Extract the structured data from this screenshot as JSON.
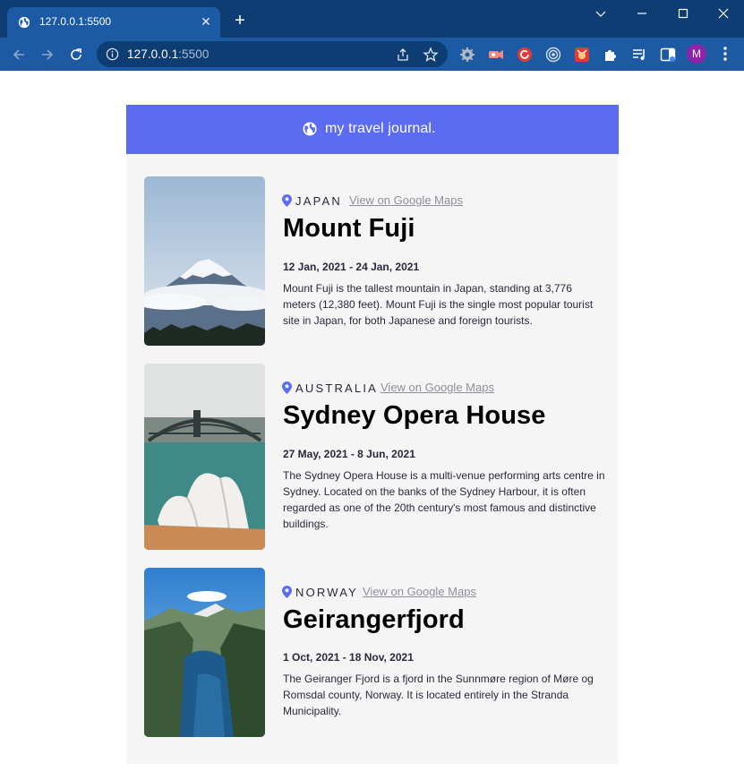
{
  "browser": {
    "tab_title": "127.0.0.1:5500",
    "url_host": "127.0.0.1",
    "url_port": ":5500",
    "profile_initial": "M"
  },
  "page": {
    "header_title": "my travel journal.",
    "map_link_label": "View on Google Maps",
    "accent_color": "#5b6cf2",
    "pin_color": "#5b6cf2",
    "entries": [
      {
        "country": "JAPAN",
        "title": "Mount Fuji",
        "start_date": "12 Jan, 2021",
        "end_date": "24 Jan, 2021",
        "description": "Mount Fuji is the tallest mountain in Japan, standing at 3,776 meters (12,380 feet). Mount Fuji is the single most popular tourist site in Japan, for both Japanese and foreign tourists."
      },
      {
        "country": "AUSTRALIA",
        "title": "Sydney Opera House",
        "start_date": "27 May, 2021",
        "end_date": "8 Jun, 2021",
        "description": "The Sydney Opera House is a multi-venue performing arts centre in Sydney. Located on the banks of the Sydney Harbour, it is often regarded as one of the 20th century's most famous and distinctive buildings."
      },
      {
        "country": "NORWAY",
        "title": "Geirangerfjord",
        "start_date": "1 Oct, 2021",
        "end_date": "18 Nov, 2021",
        "description": "The Geiranger Fjord is a fjord in the Sunnmøre region of Møre og Romsdal county, Norway. It is located entirely in the Stranda Municipality."
      }
    ]
  }
}
